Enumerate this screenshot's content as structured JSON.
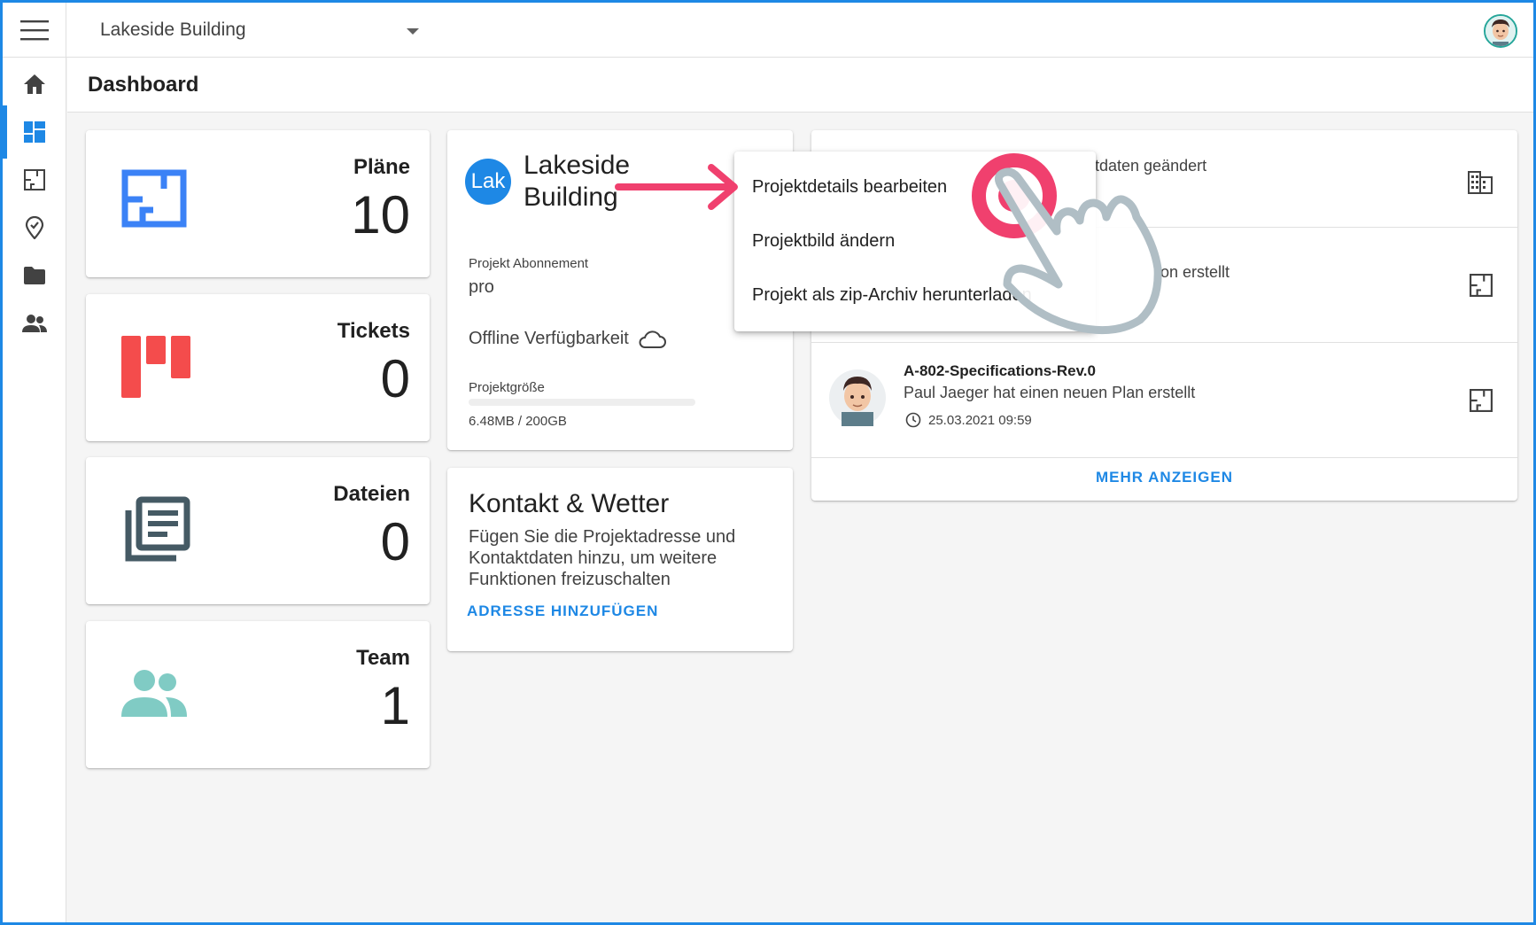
{
  "topbar": {
    "project_name": "Lakeside Building"
  },
  "sidenav": {
    "items": [
      {
        "icon": "home-icon"
      },
      {
        "icon": "dashboard-icon",
        "active": true
      },
      {
        "icon": "plan-icon"
      },
      {
        "icon": "ticket-pin-icon"
      },
      {
        "icon": "folder-icon"
      },
      {
        "icon": "team-icon"
      }
    ]
  },
  "page": {
    "title": "Dashboard"
  },
  "stats": [
    {
      "label": "Pläne",
      "value": "10",
      "icon": "plan-icon",
      "color": "#3b82f6"
    },
    {
      "label": "Tickets",
      "value": "0",
      "icon": "ticket-icon",
      "color": "#f44c4c"
    },
    {
      "label": "Dateien",
      "value": "0",
      "icon": "files-icon",
      "color": "#455a64"
    },
    {
      "label": "Team",
      "value": "1",
      "icon": "team-icon",
      "color": "#80cbc4"
    }
  ],
  "project_card": {
    "badge": "Lak",
    "name": "Lakeside Building",
    "subscription_label": "Projekt Abonnement",
    "subscription_value": "pro",
    "offline_label": "Offline Verfügbarkeit",
    "size_label": "Projektgröße",
    "size_value": "6.48MB / 200GB",
    "size_fraction": 3e-05
  },
  "contact_card": {
    "title": "Kontakt & Wetter",
    "text": "Fügen Sie die Projektadresse und Kontaktdaten hinzu, um weitere Funktionen freizuschalten",
    "button": "ADRESSE HINZUFÜGEN"
  },
  "activity": {
    "items": [
      {
        "text": "tdaten geändert",
        "icon": "building-icon"
      },
      {
        "text": "ion erstellt",
        "icon": "plan-icon"
      },
      {
        "title": "A-802-Specifications-Rev.0",
        "text": "Paul Jaeger hat einen neuen Plan erstellt",
        "time": "25.03.2021 09:59",
        "icon": "plan-icon"
      }
    ],
    "more_button": "MEHR ANZEIGEN"
  },
  "context_menu": {
    "items": [
      "Projektdetails bearbeiten",
      "Projektbild ändern",
      "Projekt als zip-Archiv herunterladen"
    ]
  },
  "colors": {
    "accent": "#1e88e5",
    "annotation": "#f0406e"
  }
}
